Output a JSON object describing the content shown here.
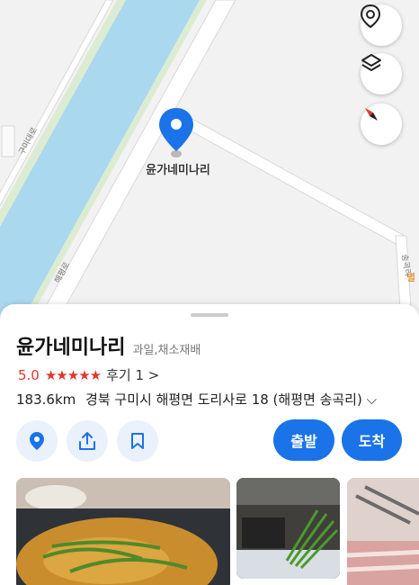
{
  "map": {
    "place_label": "윤가네미나리",
    "road_labels": [
      "구미대로",
      "해평로",
      "송곡리",
      "별"
    ]
  },
  "map_controls": {
    "location_icon": "current-location-icon",
    "layers_icon": "layers-icon",
    "compass_icon": "compass-icon"
  },
  "place": {
    "name": "윤가네미나리",
    "category": "과일,채소재배",
    "score": "5.0",
    "stars": "★★★★★",
    "reviews": "후기 1 >",
    "distance": "183.6km",
    "address": "경북 구미시 해평면 도리사로 18 (해평면 송곡리) ⌵"
  },
  "actions": {
    "depart_label": "출발",
    "arrive_label": "도착"
  },
  "colors": {
    "accent": "#1a73e8",
    "rating": "#e0362b",
    "river": "#a9d8ee"
  }
}
